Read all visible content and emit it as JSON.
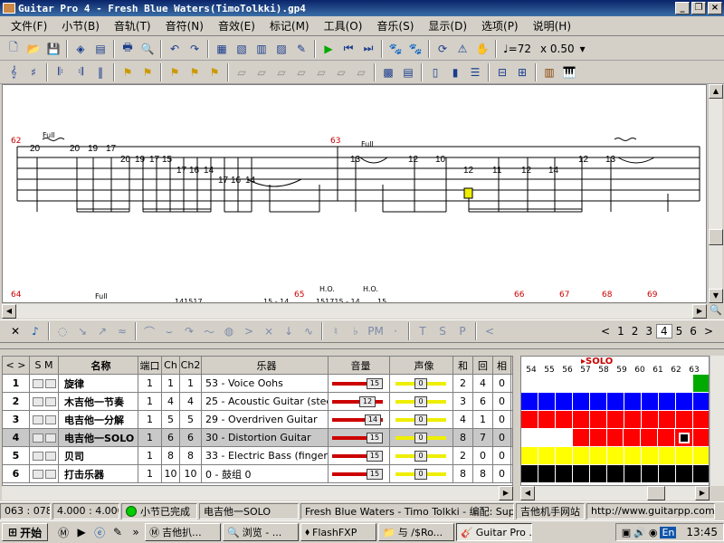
{
  "window": {
    "title": "Guitar Pro 4 - Fresh Blue Waters(TimoTolkki).gp4"
  },
  "menu": [
    "文件(F)",
    "小节(B)",
    "音轨(T)",
    "音符(N)",
    "音效(E)",
    "标记(M)",
    "工具(O)",
    "音乐(S)",
    "显示(D)",
    "选项(P)",
    "说明(H)"
  ],
  "toolbar": {
    "tempo_value": "♩=72",
    "speed": "x 0.50"
  },
  "score": {
    "measure_numbers": [
      "62",
      "63",
      "64",
      "65",
      "66",
      "67",
      "68",
      "69"
    ],
    "bend_labels": [
      "Full",
      "Full",
      "Full"
    ],
    "ho_labels": [
      "H.O.",
      "H.O."
    ],
    "fret_numbers_m62": [
      "20",
      "20",
      "19",
      "17",
      "20",
      "19",
      "17",
      "15",
      "17",
      "16",
      "14",
      "17",
      "16",
      "14"
    ],
    "fret_numbers_m63": [
      "13",
      "12",
      "10",
      "12",
      "11",
      "12",
      "14",
      "12",
      "13"
    ],
    "bottom_preview": [
      "141517",
      "15 - 14",
      "151715 - 14",
      "15"
    ]
  },
  "pager": {
    "pages": [
      "1",
      "2",
      "3",
      "4",
      "5",
      "6"
    ],
    "current": "4"
  },
  "tracks": {
    "headers": {
      "nav": "< >",
      "sm": "S M",
      "name": "名称",
      "port": "端口",
      "ch": "Ch",
      "ch2": "Ch2",
      "instrument": "乐器",
      "volume": "音量",
      "pan": "声像",
      "chorus": "和",
      "reverb": "回",
      "col5": "相"
    },
    "rows": [
      {
        "num": "1",
        "name": "旋律",
        "port": "1",
        "ch": "1",
        "ch2": "1",
        "instrument": "53 - Voice Oohs",
        "volume": "15",
        "pan": "0",
        "chorus": "2",
        "reverb": "4",
        "col5": "0"
      },
      {
        "num": "2",
        "name": "木吉他一节奏",
        "port": "1",
        "ch": "4",
        "ch2": "4",
        "instrument": "25 - Acoustic Guitar (steel)",
        "volume": "12",
        "pan": "0",
        "chorus": "3",
        "reverb": "6",
        "col5": "0"
      },
      {
        "num": "3",
        "name": "电吉他一分解",
        "port": "1",
        "ch": "5",
        "ch2": "5",
        "instrument": "29 - Overdriven Guitar",
        "volume": "14",
        "pan": "0",
        "chorus": "4",
        "reverb": "1",
        "col5": "0"
      },
      {
        "num": "4",
        "name": "电吉他一SOLO",
        "port": "1",
        "ch": "6",
        "ch2": "6",
        "instrument": "30 - Distortion Guitar",
        "volume": "15",
        "pan": "0",
        "chorus": "8",
        "reverb": "7",
        "col5": "0"
      },
      {
        "num": "5",
        "name": "贝司",
        "port": "1",
        "ch": "8",
        "ch2": "8",
        "instrument": "33 - Electric Bass (finger)",
        "volume": "15",
        "pan": "0",
        "chorus": "2",
        "reverb": "0",
        "col5": "0"
      },
      {
        "num": "6",
        "name": "打击乐器",
        "port": "1",
        "ch": "10",
        "ch2": "10",
        "instrument": "0 - 鼓组 0",
        "volume": "15",
        "pan": "0",
        "chorus": "8",
        "reverb": "8",
        "col5": "0"
      }
    ]
  },
  "grid": {
    "marker": "SOLO",
    "columns": [
      "54",
      "55",
      "56",
      "57",
      "58",
      "59",
      "60",
      "61",
      "62",
      "63"
    ],
    "row_colors": [
      "#ffffff",
      "#0000ff",
      "#ff0000",
      "#ff0000",
      "#ffff00",
      "#000000"
    ]
  },
  "status": {
    "position": "063 : 078",
    "time": "4.000 : 4.000",
    "state": "小节已完成",
    "track": "电吉他一SOLO",
    "song": "Fresh Blue Waters - Timo Tolkki - 编配: Super",
    "site_name": "吉他机手网站",
    "site_url": "http://www.guitarpp.com"
  },
  "taskbar": {
    "start": "开始",
    "tasks": [
      "吉他扒...",
      "浏览 - ...",
      "FlashFXP",
      "与 /$Ro...",
      "Guitar Pro ..."
    ],
    "tray_lang": "En",
    "clock": "13:45"
  }
}
